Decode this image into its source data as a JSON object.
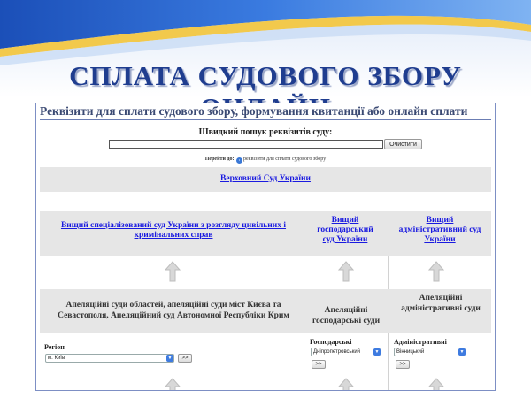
{
  "slide": {
    "title": "СПЛАТА СУДОВОГО ЗБОРУ ОНЛАЙН",
    "colors": {
      "wave_blue": "#1f5bc7",
      "wave_yellow": "#f2c94c",
      "title": "#1f3d8f"
    }
  },
  "panel": {
    "header": "Реквізити для сплати судового збору, формування квитанції або онлайн сплати",
    "search": {
      "label": "Швидкий пошук реквізитів суду:",
      "value": "",
      "placeholder": "",
      "clear_label": "Очистити"
    },
    "goto": {
      "label": "Перейти до:",
      "icon": "circle-arrow-icon",
      "link": "реквізити для сплати судового збору"
    },
    "supreme_court": "Верховний Суд України",
    "high_courts": [
      "Вищий спеціалізований суд України з розгляду цивільних і кримінальних справ",
      "Вищий господарський суд України",
      "Вищий адміністративний суд України"
    ],
    "appeal_courts": [
      "Апеляційні суди областей, апеляційні суди міст Києва та Севастополя, Апеляційний суд Автономної Республіки Крим",
      "Апеляційні господарські суди",
      "Апеляційні адміністративні суди"
    ],
    "selects": [
      {
        "label": "Регіон",
        "value": "м. Київ",
        "go_label": ">>"
      },
      {
        "label": "Господарські",
        "value": "Дніпропетровський",
        "go_label": ">>"
      },
      {
        "label": "Адміністративні",
        "value": "Вінницький",
        "go_label": ">>"
      }
    ]
  }
}
